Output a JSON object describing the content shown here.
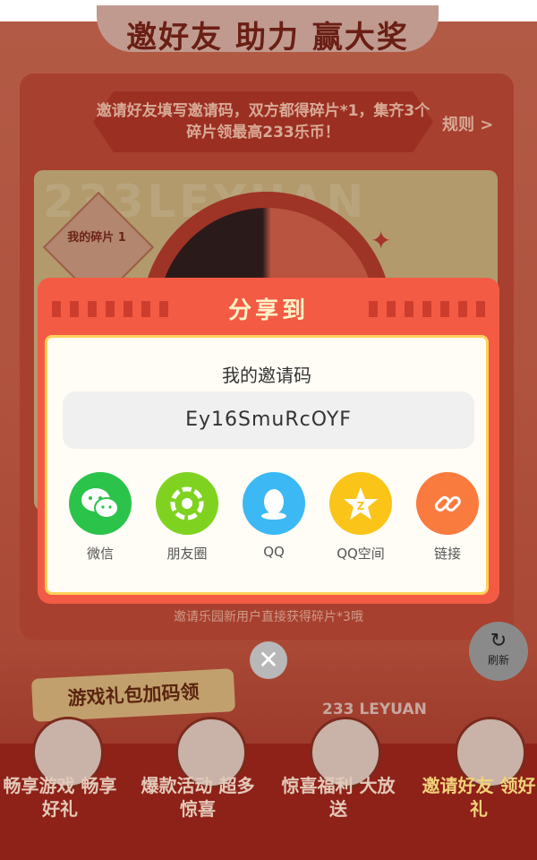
{
  "background": {
    "ribbon_text": "邀请好友填写邀请码，双方都得碎片*1，集齐3个碎片领最高233乐币！",
    "rules_link": "规则 >",
    "wheel_watermark": "233LEYUAN",
    "shard_badge": "我的碎片 1",
    "invite_note": "邀请乐园新用户直接获得碎片*3哦",
    "gift_tag": "游戏礼包加码领",
    "brand_text": "233 LEYUAN",
    "footer_items": [
      {
        "label": "畅享游戏 畅享好礼"
      },
      {
        "label": "爆款活动 超多惊喜"
      },
      {
        "label": "惊喜福利 大放送"
      },
      {
        "label": "邀请好友 领好礼"
      }
    ]
  },
  "refresh_button": {
    "label": "刷新",
    "icon": "refresh-icon"
  },
  "dialog": {
    "title": "分享到",
    "code_label": "我的邀请码",
    "invite_code": "Ey16SmuRcOYF",
    "share_options": [
      {
        "label": "微信",
        "icon": "wechat-icon",
        "color": "#2bc34a"
      },
      {
        "label": "朋友圈",
        "icon": "moments-icon",
        "color": "#7fd320"
      },
      {
        "label": "QQ",
        "icon": "qq-icon",
        "color": "#3cb8f5"
      },
      {
        "label": "QQ空间",
        "icon": "qzone-icon",
        "color": "#fbc419"
      },
      {
        "label": "链接",
        "icon": "link-icon",
        "color": "#fa7b3e"
      }
    ]
  },
  "close_button": {
    "icon": "close-icon"
  },
  "colors": {
    "dialog_accent": "#f45b44",
    "dialog_border": "#ffd15a"
  }
}
